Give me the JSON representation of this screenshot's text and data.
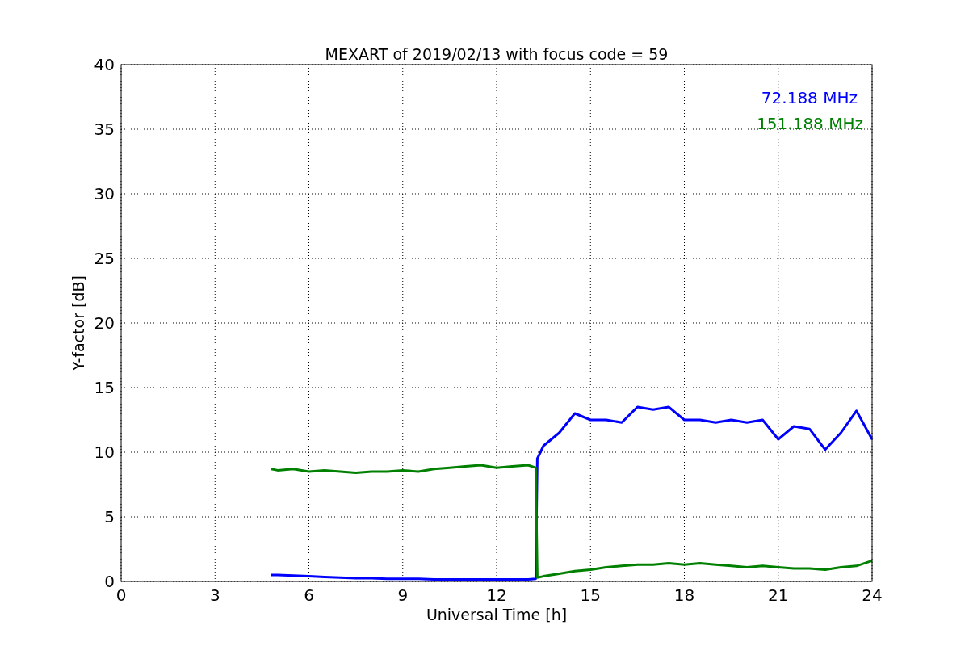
{
  "figure": {
    "chart_data": {
      "type": "line",
      "title": "MEXART of 2019/02/13 with focus code = 59",
      "xlabel": "Universal Time [h]",
      "ylabel": "Y-factor [dB]",
      "x": [
        4.8,
        5,
        5.5,
        6,
        6.5,
        7,
        7.5,
        8,
        8.5,
        9,
        9.5,
        10,
        10.5,
        11,
        11.5,
        12,
        12.5,
        13,
        13.25,
        13.3,
        13.5,
        14,
        14.5,
        15,
        15.5,
        16,
        16.5,
        17,
        17.5,
        18,
        18.5,
        19,
        19.5,
        20,
        20.5,
        21,
        21.5,
        22,
        22.5,
        23,
        23.5,
        24
      ],
      "series": [
        {
          "name": "72.188 MHz",
          "color": "#0000ff",
          "values": [
            0.5,
            0.5,
            0.45,
            0.4,
            0.35,
            0.3,
            0.25,
            0.25,
            0.2,
            0.2,
            0.2,
            0.15,
            0.15,
            0.15,
            0.15,
            0.15,
            0.15,
            0.15,
            0.2,
            9.5,
            10.5,
            11.5,
            13,
            12.5,
            12.5,
            12.3,
            13.5,
            13.3,
            13.5,
            12.5,
            12.5,
            12.3,
            12.5,
            12.3,
            12.5,
            11,
            12,
            11.8,
            10.2,
            11.5,
            13.2,
            11
          ]
        },
        {
          "name": "151.188 MHz",
          "color": "#008000",
          "values": [
            8.7,
            8.6,
            8.7,
            8.5,
            8.6,
            8.5,
            8.4,
            8.5,
            8.5,
            8.6,
            8.5,
            8.7,
            8.8,
            8.9,
            9,
            8.8,
            8.9,
            9,
            8.8,
            0.3,
            0.4,
            0.6,
            0.8,
            0.9,
            1.1,
            1.2,
            1.3,
            1.3,
            1.4,
            1.3,
            1.4,
            1.3,
            1.2,
            1.1,
            1.2,
            1.1,
            1,
            1,
            0.9,
            1.1,
            1.2,
            1.6
          ]
        }
      ],
      "grid": true,
      "xlim": [
        0,
        24
      ],
      "ylim": [
        0,
        40
      ],
      "xticks": [
        0,
        3,
        6,
        9,
        12,
        15,
        18,
        21,
        24
      ],
      "yticks": [
        0,
        5,
        10,
        15,
        20,
        25,
        30,
        35,
        40
      ]
    }
  }
}
